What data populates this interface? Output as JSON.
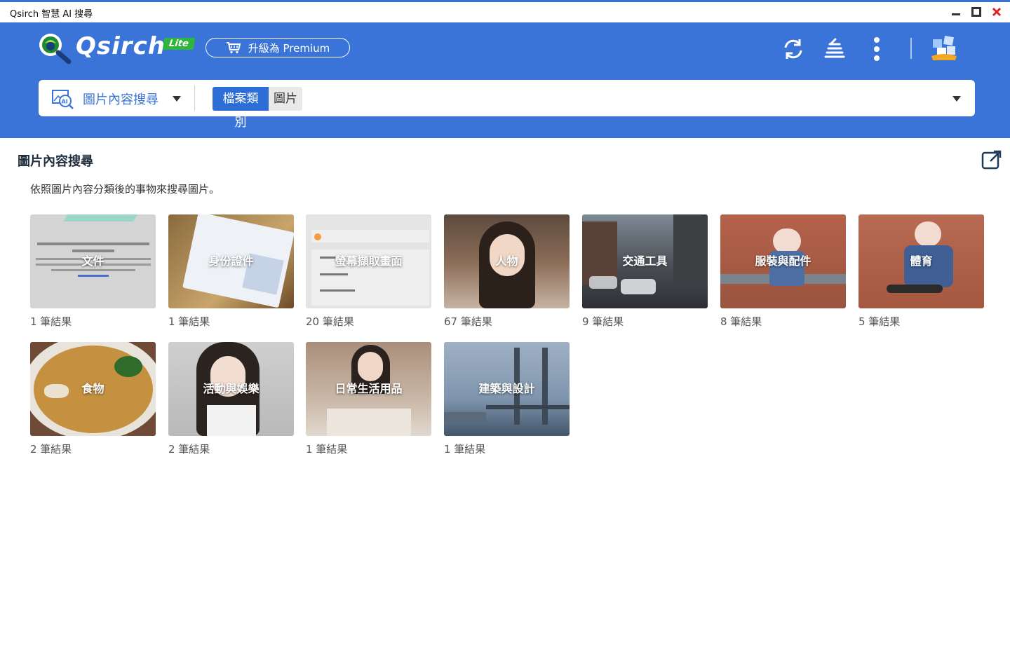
{
  "window": {
    "title": "Qsirch 智慧 AI 搜尋"
  },
  "header": {
    "brand": "Qsirch",
    "badge": "Lite",
    "premium_button": "升級為 Premium",
    "accent_color": "#3b74d8"
  },
  "search_bar": {
    "mode_label": "圖片內容搜尋",
    "filter_key": "檔案類別",
    "filter_value": "圖片"
  },
  "section": {
    "title": "圖片內容搜尋",
    "description": "依照圖片內容分類後的事物來搜尋圖片。"
  },
  "categories": [
    {
      "label": "文件",
      "count": "1 筆結果",
      "icon": "document-thumbnail"
    },
    {
      "label": "身份證件",
      "count": "1 筆結果",
      "icon": "id-card-thumbnail"
    },
    {
      "label": "螢幕擷取畫面",
      "count": "20 筆結果",
      "icon": "screenshot-thumbnail"
    },
    {
      "label": "人物",
      "count": "67 筆結果",
      "icon": "person-thumbnail"
    },
    {
      "label": "交通工具",
      "count": "9 筆結果",
      "icon": "vehicle-thumbnail"
    },
    {
      "label": "服裝與配件",
      "count": "8 筆結果",
      "icon": "clothing-thumbnail"
    },
    {
      "label": "體育",
      "count": "5 筆結果",
      "icon": "sport-thumbnail"
    },
    {
      "label": "食物",
      "count": "2 筆結果",
      "icon": "food-thumbnail"
    },
    {
      "label": "活動與娛樂",
      "count": "2 筆結果",
      "icon": "activity-thumbnail"
    },
    {
      "label": "日常生活用品",
      "count": "1 筆結果",
      "icon": "household-thumbnail"
    },
    {
      "label": "建築與設計",
      "count": "1 筆結果",
      "icon": "architecture-thumbnail"
    }
  ]
}
